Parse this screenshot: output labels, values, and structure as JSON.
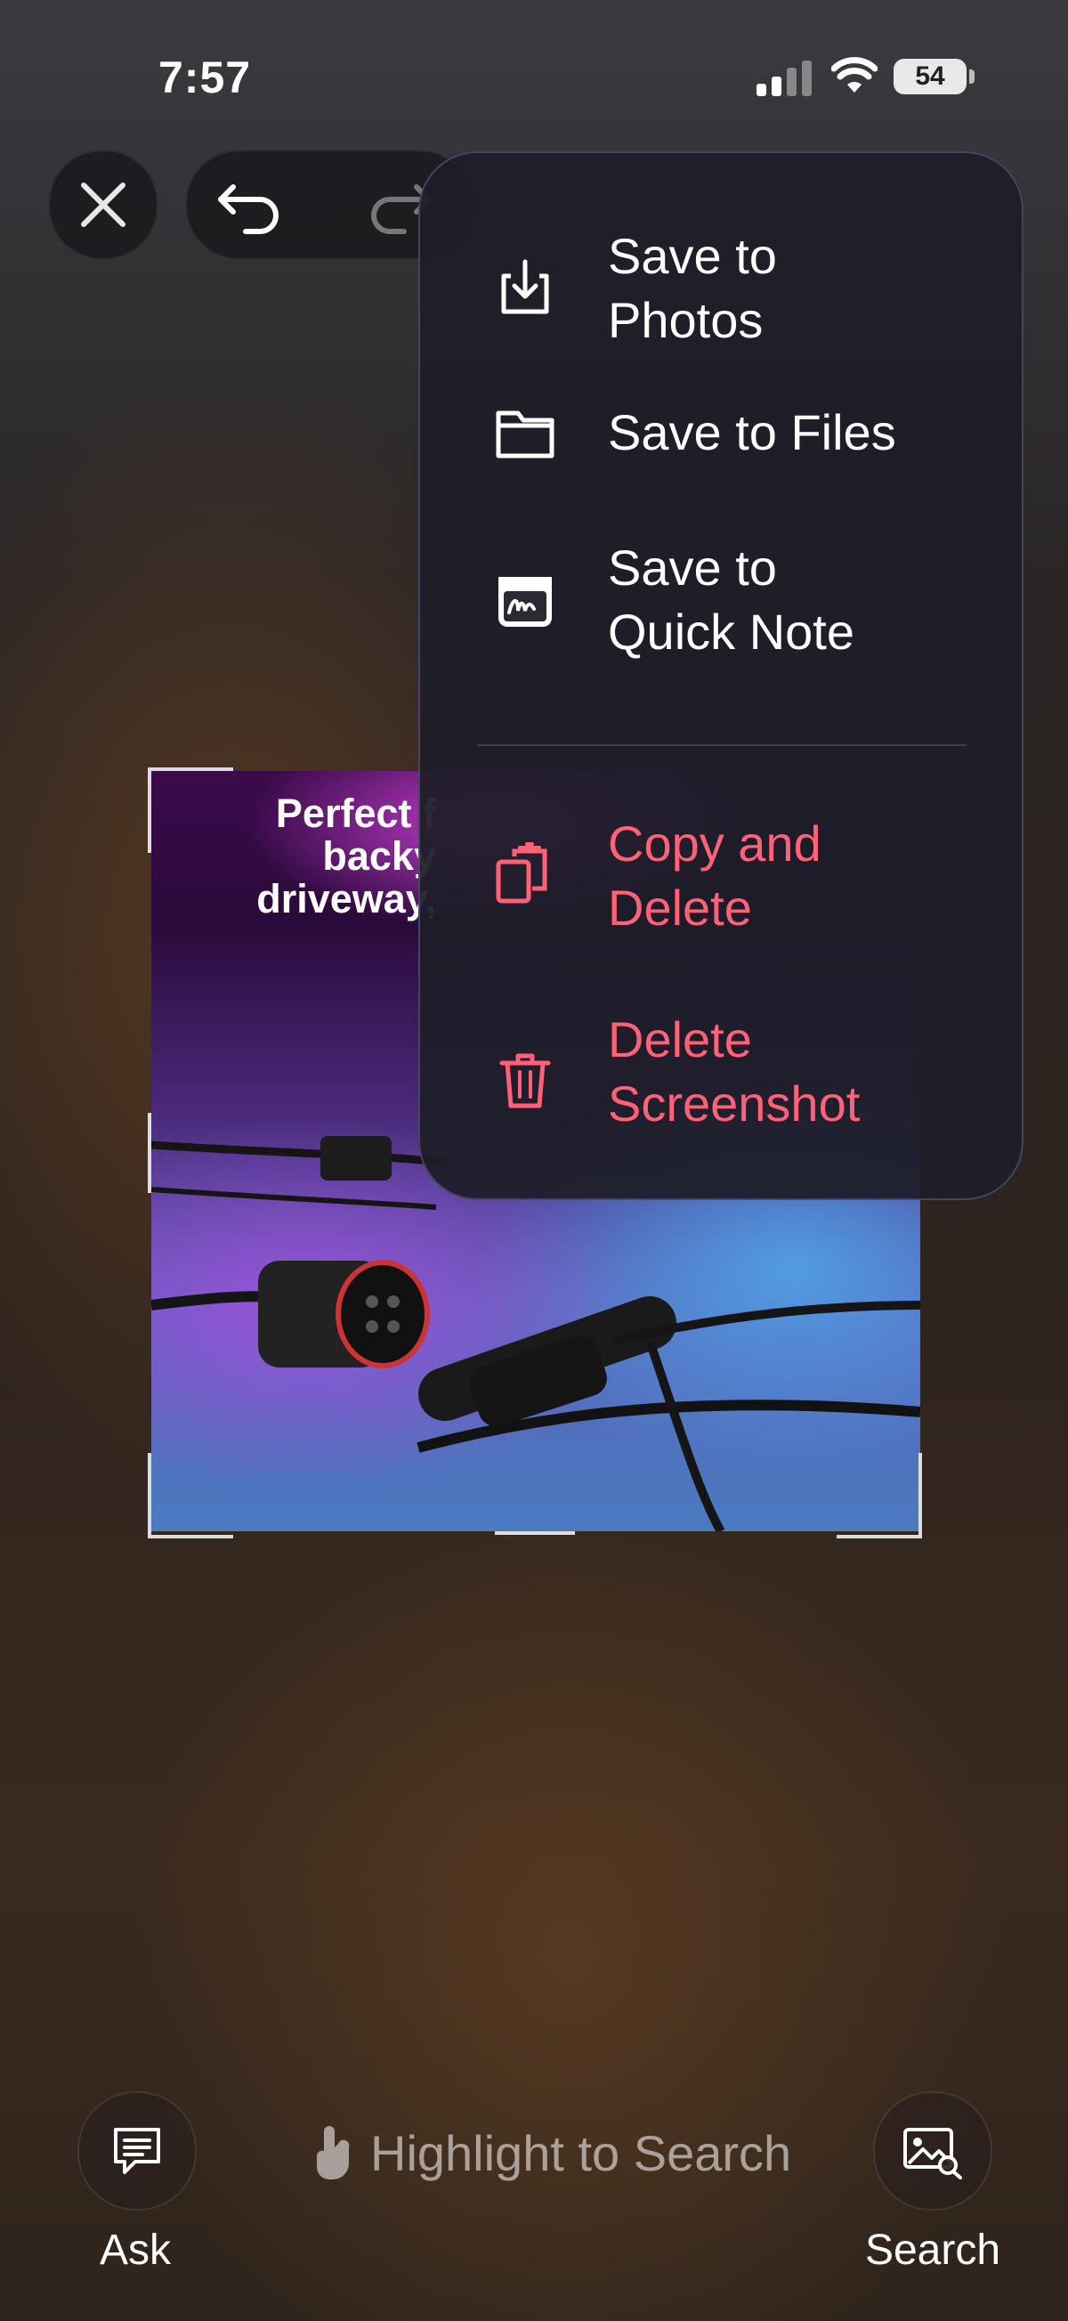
{
  "status_bar": {
    "time": "7:57",
    "battery": "54"
  },
  "toolbar": {
    "close_icon": "xmark",
    "undo_icon": "arrow-uturn-left",
    "redo_icon": "arrow-uturn-right"
  },
  "preview": {
    "text": "Perfect f\nbacky\ndriveway,"
  },
  "menu": {
    "items": [
      {
        "label": "Save to\nPhotos",
        "icon": "tray-arrow-down"
      },
      {
        "label": "Save to Files",
        "icon": "folder"
      },
      {
        "label": "Save to\nQuick Note",
        "icon": "quick-note"
      },
      {
        "label": "Copy and\nDelete",
        "icon": "copy-trash",
        "destructive": true
      },
      {
        "label": "Delete\nScreenshot",
        "icon": "trash",
        "destructive": true
      }
    ],
    "destructive_color": "#ff6277"
  },
  "bottom": {
    "ask_label": "Ask",
    "search_label": "Search",
    "hint": "Highlight to Search"
  }
}
